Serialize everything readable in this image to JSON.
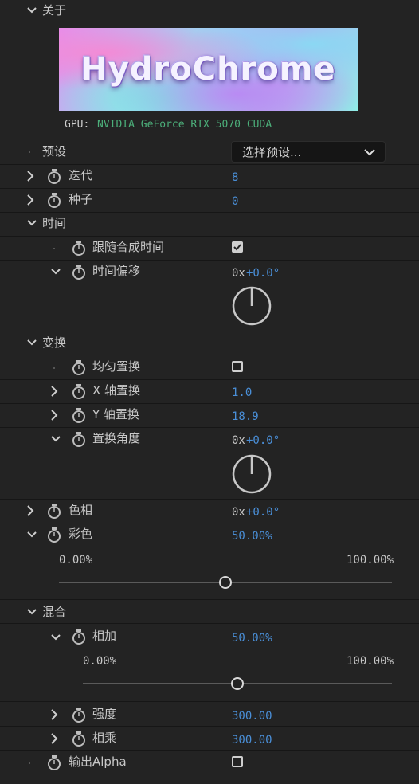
{
  "sections": {
    "about": "关于",
    "time": "时间",
    "transform": "变换",
    "blend": "混合"
  },
  "banner": {
    "title": "HydroChrome"
  },
  "gpu": {
    "label": "GPU:",
    "value": "NVIDIA GeForce RTX 5070 CUDA"
  },
  "preset": {
    "label": "预设",
    "selected": "选择预设..."
  },
  "params": {
    "iterations": {
      "label": "迭代",
      "value": "8"
    },
    "seed": {
      "label": "种子",
      "value": "0"
    },
    "follow_time": {
      "label": "跟随合成时间",
      "checked": true
    },
    "time_offset": {
      "label": "时间偏移",
      "value_x": "0x",
      "value_deg": "+0.0°"
    },
    "uniform_displace": {
      "label": "均匀置换",
      "checked": false
    },
    "x_displace": {
      "label": "X 轴置换",
      "value": "1.0"
    },
    "y_displace": {
      "label": "Y 轴置换",
      "value": "18.9"
    },
    "displace_angle": {
      "label": "置换角度",
      "value_x": "0x",
      "value_deg": "+0.0°"
    },
    "hue": {
      "label": "色相",
      "value_x": "0x",
      "value_deg": "+0.0°"
    },
    "color": {
      "label": "彩色",
      "value": "50.00%",
      "min": "0.00%",
      "max": "100.00%",
      "fraction": 0.5
    },
    "add": {
      "label": "相加",
      "value": "50.00%",
      "min": "0.00%",
      "max": "100.00%",
      "fraction": 0.5
    },
    "intensity": {
      "label": "强度",
      "value": "300.00"
    },
    "multiply": {
      "label": "相乘",
      "value": "300.00"
    },
    "output_alpha": {
      "label": "输出Alpha",
      "checked": false
    }
  },
  "colors": {
    "value_blue": "#4a8fd8",
    "gpu_green": "#4caf7a"
  }
}
